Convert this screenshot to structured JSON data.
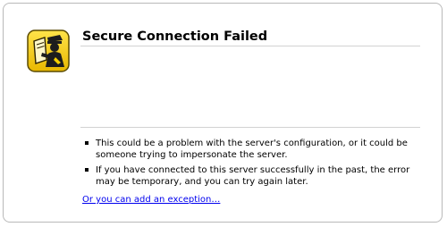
{
  "page": {
    "title": "Secure Connection Failed",
    "icon": "police-officer-warning-icon"
  },
  "bullets": [
    "This could be a problem with the server's configuration, or it could be someone trying to impersonate the server.",
    "If you have connected to this server successfully in the past, the error may be temporary, and you can try again later."
  ],
  "link": {
    "label": "Or you can add an exception…"
  },
  "colors": {
    "icon_background": "#f5d000",
    "link": "#0000ee",
    "rule": "#d2d2d2"
  }
}
